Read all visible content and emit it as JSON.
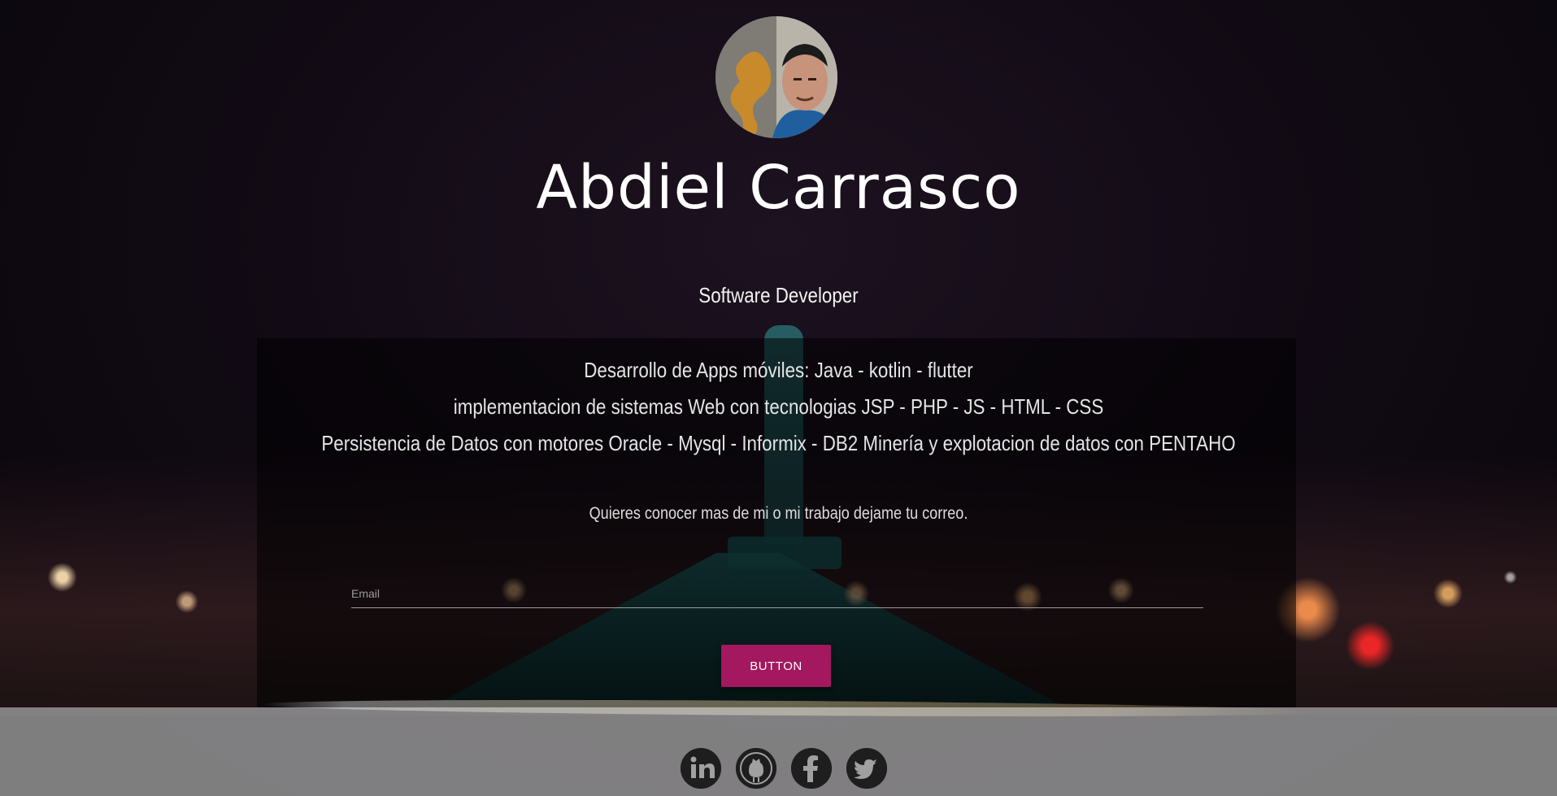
{
  "profile": {
    "name": "Abdiel Carrasco",
    "role": "Software Developer"
  },
  "skills": [
    "Desarrollo de Apps móviles: Java - kotlin - flutter",
    "implementacion de sistemas Web con tecnologias JSP - PHP - JS - HTML - CSS",
    "Persistencia de Datos con motores Oracle - Mysql - Informix - DB2 Minería y explotacion de datos con PENTAHO"
  ],
  "contact": {
    "prompt": "Quieres conocer mas de mi o mi trabajo dejame tu correo.",
    "email_placeholder": "Email",
    "email_value": "",
    "button_label": "BUTTON"
  },
  "social": [
    {
      "icon": "linkedin-icon"
    },
    {
      "icon": "github-icon"
    },
    {
      "icon": "facebook-icon"
    },
    {
      "icon": "twitter-icon"
    }
  ],
  "colors": {
    "accent": "#a3185f",
    "footer": "#a0a0a0",
    "panel": "#000000"
  }
}
